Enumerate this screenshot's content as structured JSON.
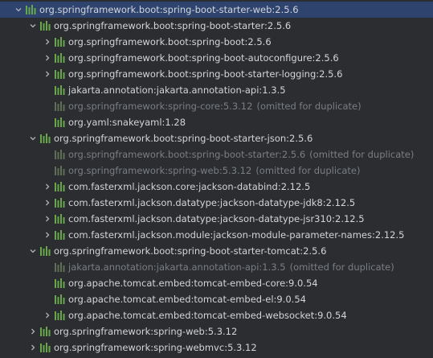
{
  "icons": {
    "expand": "chevron-right-icon",
    "collapse": "chevron-down-icon",
    "library": "maven-library-icon",
    "library_color": "#67a84a",
    "selection_color": "#2e436e"
  },
  "rows": [
    {
      "label": "org.springframework.boot:spring-boot-starter-web:2.5.6",
      "state": "expanded",
      "depth": 0,
      "selected": true
    },
    {
      "label": "org.springframework.boot:spring-boot-starter:2.5.6",
      "state": "expanded",
      "depth": 1
    },
    {
      "label": "org.springframework.boot:spring-boot:2.5.6",
      "state": "collapsed",
      "depth": 2
    },
    {
      "label": "org.springframework.boot:spring-boot-autoconfigure:2.5.6",
      "state": "collapsed",
      "depth": 2
    },
    {
      "label": "org.springframework.boot:spring-boot-starter-logging:2.5.6",
      "state": "collapsed",
      "depth": 2
    },
    {
      "label": "jakarta.annotation:jakarta.annotation-api:1.3.5",
      "state": "leaf",
      "depth": 2
    },
    {
      "label": "org.springframework:spring-core:5.3.12",
      "note": "(omitted for duplicate)",
      "state": "leaf",
      "depth": 2,
      "dim": true
    },
    {
      "label": "org.yaml:snakeyaml:1.28",
      "state": "leaf",
      "depth": 2
    },
    {
      "label": "org.springframework.boot:spring-boot-starter-json:2.5.6",
      "state": "expanded",
      "depth": 1
    },
    {
      "label": "org.springframework.boot:spring-boot-starter:2.5.6",
      "note": "(omitted for duplicate)",
      "state": "leaf",
      "depth": 2,
      "dim": true
    },
    {
      "label": "org.springframework:spring-web:5.3.12",
      "note": "(omitted for duplicate)",
      "state": "leaf",
      "depth": 2,
      "dim": true
    },
    {
      "label": "com.fasterxml.jackson.core:jackson-databind:2.12.5",
      "state": "collapsed",
      "depth": 2
    },
    {
      "label": "com.fasterxml.jackson.datatype:jackson-datatype-jdk8:2.12.5",
      "state": "collapsed",
      "depth": 2
    },
    {
      "label": "com.fasterxml.jackson.datatype:jackson-datatype-jsr310:2.12.5",
      "state": "collapsed",
      "depth": 2
    },
    {
      "label": "com.fasterxml.jackson.module:jackson-module-parameter-names:2.12.5",
      "state": "collapsed",
      "depth": 2
    },
    {
      "label": "org.springframework.boot:spring-boot-starter-tomcat:2.5.6",
      "state": "expanded",
      "depth": 1
    },
    {
      "label": "jakarta.annotation:jakarta.annotation-api:1.3.5",
      "note": "(omitted for duplicate)",
      "state": "leaf",
      "depth": 2,
      "dim": true
    },
    {
      "label": "org.apache.tomcat.embed:tomcat-embed-core:9.0.54",
      "state": "leaf",
      "depth": 2
    },
    {
      "label": "org.apache.tomcat.embed:tomcat-embed-el:9.0.54",
      "state": "leaf",
      "depth": 2
    },
    {
      "label": "org.apache.tomcat.embed:tomcat-embed-websocket:9.0.54",
      "state": "collapsed",
      "depth": 2
    },
    {
      "label": "org.springframework:spring-web:5.3.12",
      "state": "collapsed",
      "depth": 1
    },
    {
      "label": "org.springframework:spring-webmvc:5.3.12",
      "state": "collapsed",
      "depth": 1
    }
  ]
}
